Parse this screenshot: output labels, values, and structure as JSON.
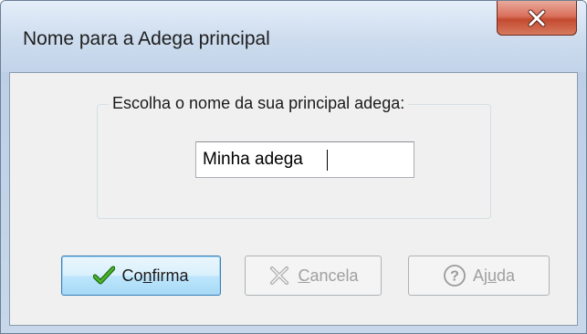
{
  "window": {
    "title": "Nome para a Adega principal",
    "close_symbol": "✕"
  },
  "group": {
    "label": "Escolha o nome da sua principal adega:"
  },
  "name_field": {
    "value": "Minha adega"
  },
  "buttons": {
    "confirm": {
      "before": "Co",
      "mnemonic": "n",
      "after": "firma",
      "icon": "check-icon",
      "enabled": true,
      "default": true
    },
    "cancel": {
      "before": "",
      "mnemonic": "C",
      "after": "ancela",
      "icon": "cross-icon",
      "enabled": false
    },
    "help": {
      "before": "Aj",
      "mnemonic": "u",
      "after": "da",
      "icon": "help-icon",
      "enabled": false
    }
  }
}
